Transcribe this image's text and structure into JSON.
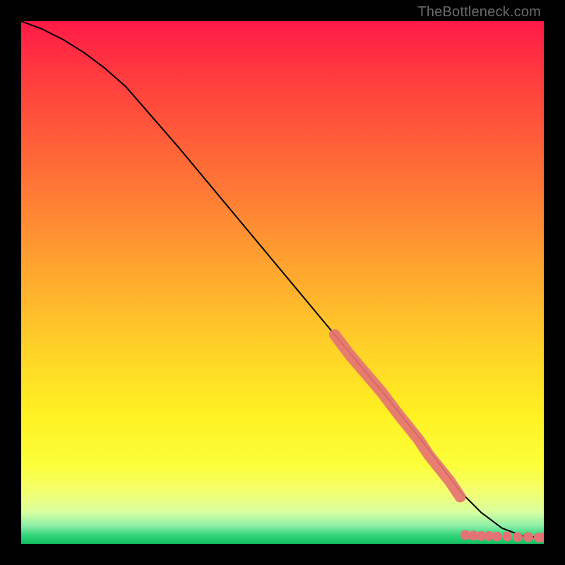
{
  "watermark": "TheBottleneck.com",
  "chart_data": {
    "type": "line",
    "title": "",
    "xlabel": "",
    "ylabel": "",
    "xlim": [
      0,
      100
    ],
    "ylim": [
      0,
      100
    ],
    "curve": {
      "x": [
        0,
        4,
        8,
        12,
        16,
        20,
        30,
        40,
        50,
        60,
        70,
        78,
        84,
        88,
        92,
        96,
        100
      ],
      "y": [
        100,
        98.5,
        96.5,
        94,
        91,
        87.5,
        76,
        64,
        52,
        40,
        28,
        18,
        10,
        6,
        3,
        1.5,
        1.2
      ]
    },
    "thick_overlay": {
      "x": [
        60,
        63,
        66,
        69,
        72,
        74,
        76,
        78,
        80,
        82,
        84
      ],
      "y": [
        40,
        36,
        32.5,
        29,
        25,
        22.5,
        20,
        17,
        14.5,
        12,
        9
      ]
    },
    "tail_dots": {
      "x": [
        85,
        86.5,
        88,
        89.5,
        91,
        93,
        95,
        97,
        99,
        100
      ],
      "y": [
        1.7,
        1.6,
        1.5,
        1.5,
        1.4,
        1.4,
        1.3,
        1.3,
        1.2,
        1.2
      ]
    },
    "dot_color": "#e57373",
    "line_color": "#000000",
    "background_gradient": [
      "#ff1a48",
      "#ffd028",
      "#fff022",
      "#2fd27a"
    ]
  }
}
